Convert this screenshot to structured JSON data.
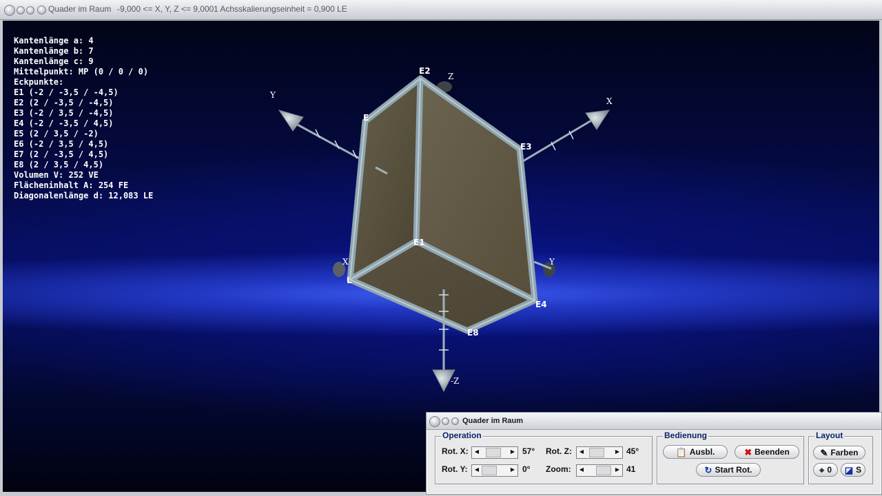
{
  "window": {
    "title": "Quader im Raum",
    "range": "-9,000 <= X, Y, Z <= 9,000",
    "scale": "1 Achsskalierungseinheit = 0,900 LE"
  },
  "info": {
    "lines": [
      "Kantenlänge a: 4",
      "Kantenlänge b: 7",
      "Kantenlänge c: 9",
      "",
      "Mittelpunkt: MP (0 / 0 / 0)",
      "",
      "Eckpunkte:",
      "",
      "E1 (-2 / -3,5 / -4,5)",
      "E2 (2 / -3,5 / -4,5)",
      "E3 (-2 / 3,5 / -4,5)",
      "E4 (-2 / -3,5 / 4,5)",
      "E5 (2 / 3,5 / -2)",
      "E6 (-2 / 3,5 / 4,5)",
      "E7 (2 / -3,5 / 4,5)",
      "E8 (2 / 3,5 / 4,5)",
      "",
      "Volumen V: 252 VE",
      "",
      "Flächeninhalt A: 254 FE",
      "",
      "Diagonalenlänge d: 12,083 LE"
    ]
  },
  "scene_labels": {
    "e1": "E1",
    "e2": "E2",
    "e3": "E3",
    "e4": "E4",
    "e8": "E8",
    "e_left": "E",
    "e_bl": "L",
    "axis_y": "Y",
    "axis_x": "X",
    "axis_z": "Z",
    "axis_negz": "-Z",
    "axis_negx": "X",
    "axis_negy": "Y"
  },
  "control": {
    "title": "Quader im Raum",
    "operation": {
      "label": "Operation",
      "rot_x_label": "Rot. X:",
      "rot_x_value": "57°",
      "rot_y_label": "Rot. Y:",
      "rot_y_value": "0°",
      "rot_z_label": "Rot. Z:",
      "rot_z_value": "45°",
      "zoom_label": "Zoom:",
      "zoom_value": "41"
    },
    "bedienung": {
      "label": "Bedienung",
      "ausbl": "Ausbl.",
      "beenden": "Beenden",
      "start_rot": "Start Rot."
    },
    "layout": {
      "label": "Layout",
      "farben": "Farben",
      "zero": "0",
      "s": "S"
    }
  },
  "colors": {
    "face": "#5f563f",
    "edge": "#8fa4ae",
    "accent": "#0a246a",
    "close_red": "#cc1111"
  }
}
